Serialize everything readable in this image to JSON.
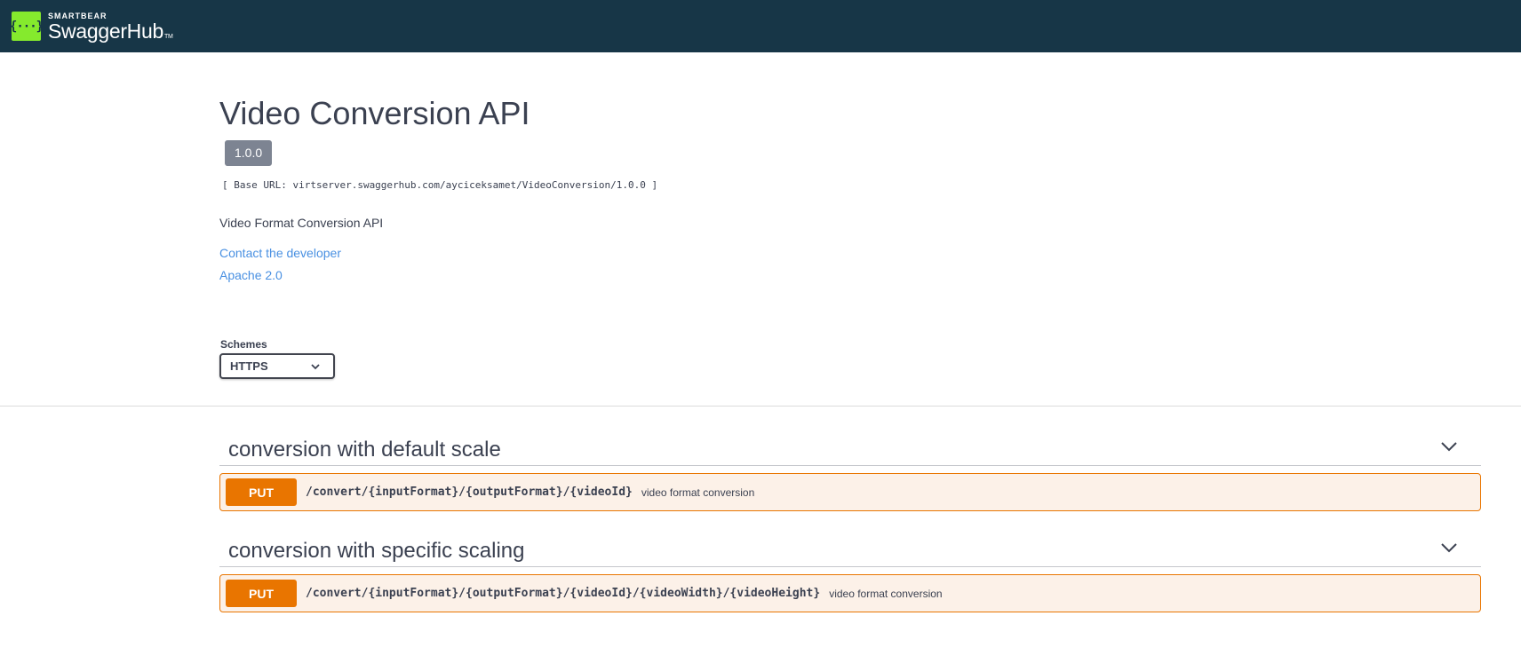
{
  "topbar": {
    "brand_small": "SMARTBEAR",
    "brand_name": "SwaggerHub",
    "brand_tm": "TM",
    "logo_glyph": "{···}",
    "bg_color": "#173647",
    "logo_color": "#85ea2d"
  },
  "info": {
    "title": "Video Conversion API",
    "version": "1.0.0",
    "base_url": "[ Base URL: virtserver.swaggerhub.com/ayciceksamet/VideoConversion/1.0.0 ]",
    "description": "Video Format Conversion API",
    "contact_link": "Contact the developer",
    "license_link": "Apache 2.0",
    "link_color": "#4990e2"
  },
  "schemes": {
    "label": "Schemes",
    "selected": "HTTPS"
  },
  "tags": [
    {
      "name": "conversion with default scale",
      "operations": [
        {
          "method": "PUT",
          "path": "/convert/{inputFormat}/{outputFormat}/{videoId}",
          "summary": "video format conversion"
        }
      ]
    },
    {
      "name": "conversion with specific scaling",
      "operations": [
        {
          "method": "PUT",
          "path": "/convert/{inputFormat}/{outputFormat}/{videoId}/{videoWidth}/{videoHeight}",
          "summary": "video format conversion"
        }
      ]
    }
  ],
  "colors": {
    "put_method": "#e97500",
    "put_bg": "#fcf1e8"
  },
  "icons": {
    "tag_toggle": "chevron-down-icon",
    "schemes_toggle": "chevron-down-icon"
  }
}
